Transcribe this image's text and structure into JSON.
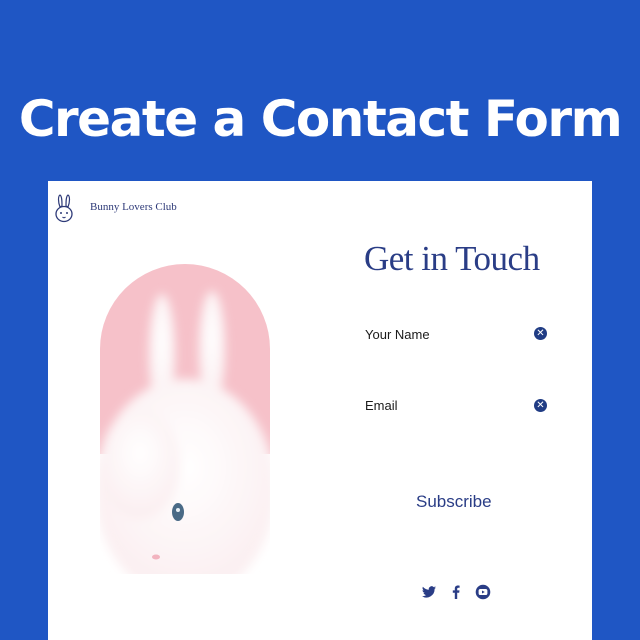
{
  "hero": {
    "title": "Create a Contact Form"
  },
  "site": {
    "brand_name": "Bunny Lovers Club"
  },
  "form": {
    "heading": "Get in Touch",
    "fields": [
      {
        "label": "Your Name",
        "clear_icon": "close-circle-icon"
      },
      {
        "label": "Email",
        "clear_icon": "close-circle-icon"
      }
    ],
    "submit_label": "Subscribe"
  },
  "social": [
    {
      "icon": "twitter-icon"
    },
    {
      "icon": "facebook-icon"
    },
    {
      "icon": "youtube-icon"
    }
  ],
  "colors": {
    "background": "#1f56c4",
    "accent": "#2a3d86",
    "photo_bg": "#f6c1c9"
  }
}
